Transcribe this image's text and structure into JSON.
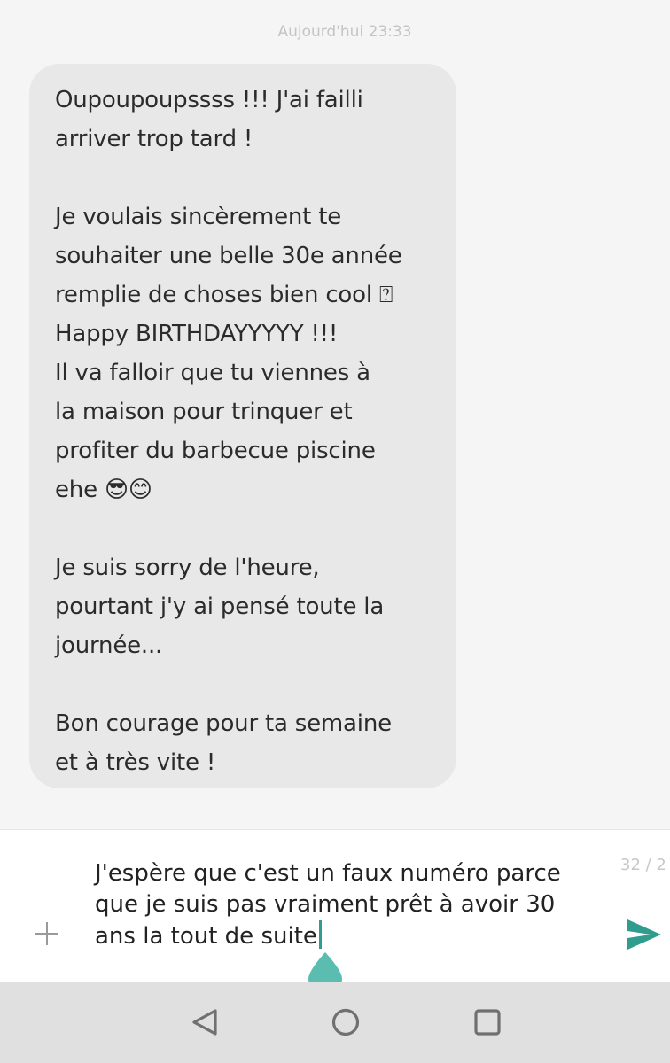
{
  "conversation": {
    "timestamp": "Aujourd'hui 23:33",
    "incoming_message": {
      "text": "Oupoupoupssss !!! J'ai failli\narriver trop tard !\n\nJe voulais sincèrement te\nsouhaiter une belle 30e année\nremplie de choses bien cool ",
      "missing_glyph": "⍰",
      "text_part2": "\nHappy BIRTHDAYYYYY !!!\nIl va falloir que tu viennes à\nla maison pour trinquer et\nprofiter du barbecue piscine\nehe ",
      "emojis": "😎😊",
      "text_part3": "\n\nJe suis sorry de l'heure,\npourtant j'y ai pensé toute la\njournée...\n\nBon courage pour ta semaine\net à très vite !"
    }
  },
  "composer": {
    "draft_text": "J'espère que c'est un faux numéro parce\nque je suis pas vraiment prêt à avoir 30\nans la tout de suite",
    "char_count": "32 / 2",
    "add_icon": "plus-icon",
    "send_icon": "send-icon",
    "accent_color": "#2f9c8e"
  },
  "navigation": {
    "back_icon": "triangle-back-icon",
    "home_icon": "circle-home-icon",
    "recents_icon": "square-recents-icon"
  }
}
